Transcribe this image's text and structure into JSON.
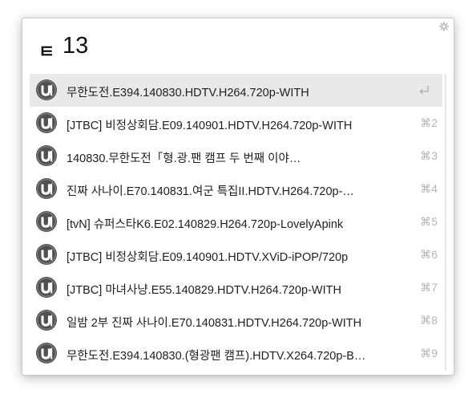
{
  "query": {
    "prefix": "ㅌ",
    "value": "13"
  },
  "icons": {
    "settings": "gear-icon",
    "result": "utorrent-icon",
    "selected_action": "return-icon"
  },
  "colors": {
    "selected_row": "#e9e9e9",
    "icon_fill": "#555555",
    "shortcut_text": "#b4b4b4"
  },
  "results": [
    {
      "title": "무한도전.E394.140830.HDTV.H264.720p-WITH",
      "shortcut": ""
    },
    {
      "title": "[JTBC] 비정상회담.E09.140901.HDTV.H264.720p-WITH",
      "shortcut": "⌘2"
    },
    {
      "title": "140830.무한도전「형.광.팬 캠프 두 번째 이야…",
      "shortcut": "⌘3"
    },
    {
      "title": "진짜 사나이.E70.140831.여군 특집II.HDTV.H264.720p-…",
      "shortcut": "⌘4"
    },
    {
      "title": "[tvN] 슈퍼스타K6.E02.140829.H264.720p-LovelyApink",
      "shortcut": "⌘5"
    },
    {
      "title": "[JTBC] 비정상회담.E09.140901.HDTV.XViD-iPOP/720p",
      "shortcut": "⌘6"
    },
    {
      "title": "[JTBC] 마녀사냥.E55.140829.HDTV.H264.720p-WITH",
      "shortcut": "⌘7"
    },
    {
      "title": "일밤 2부 진짜 사나이.E70.140831.HDTV.H264.720p-WITH",
      "shortcut": "⌘8"
    },
    {
      "title": "무한도전.E394.140830.(형광팬 캠프).HDTV.X264.720p-B…",
      "shortcut": "⌘9"
    }
  ]
}
